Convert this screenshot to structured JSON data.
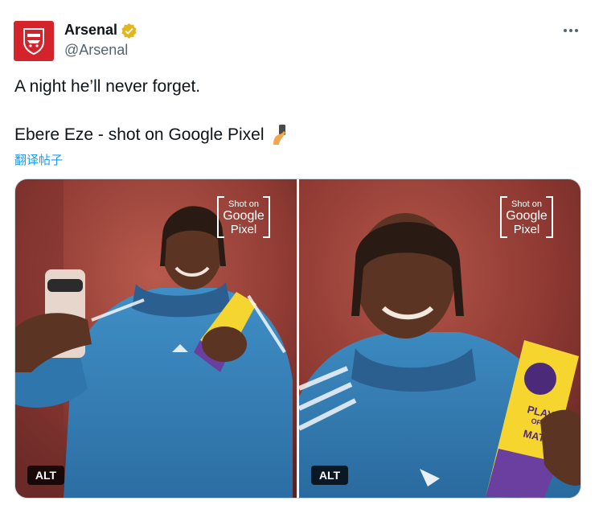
{
  "author": {
    "name": "Arsenal",
    "handle": "@Arsenal",
    "avatar_icon": "arsenal-crest-icon",
    "verified_icon": "verified-gold-badge-icon",
    "brand_color": "#d3232b",
    "verified_color": "#e2b719"
  },
  "post": {
    "line1": "A night he’ll never forget.",
    "line2": "Ebere Eze - shot on Google Pixel",
    "emoji_icon": "selfie-emoji-icon",
    "translate_label": "翻译帖子"
  },
  "media": {
    "photos": [
      {
        "badge": {
          "line1": "Shot on",
          "line2": "Google",
          "line3": "Pixel"
        },
        "alt_label": "ALT"
      },
      {
        "badge": {
          "line1": "Shot on",
          "line2": "Google",
          "line3": "Pixel"
        },
        "alt_label": "ALT",
        "trophy_text": {
          "line1": "PLAYER",
          "line2": "OF THE",
          "line3": "MATCH"
        }
      }
    ]
  },
  "more_icon": "more-options-icon"
}
